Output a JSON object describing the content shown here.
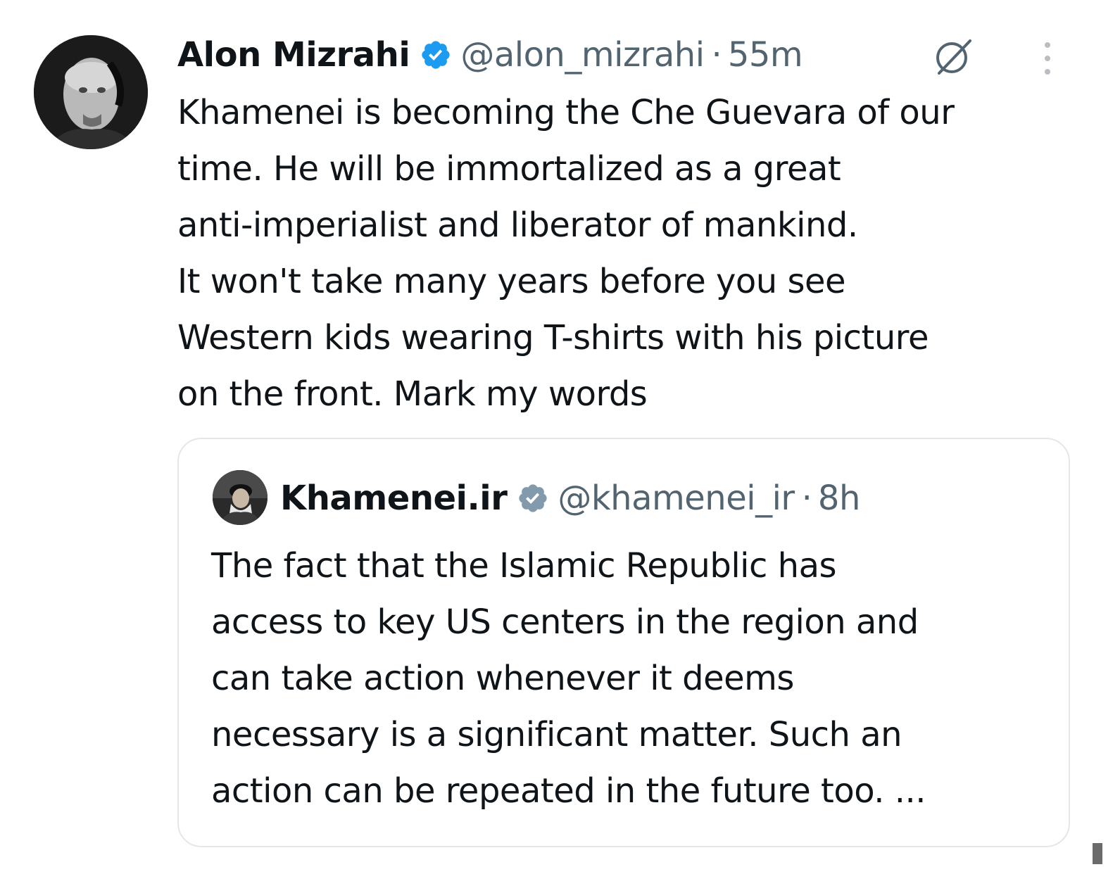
{
  "tweet": {
    "author_name": "Alon Mizrahi",
    "handle": "@alon_mizrahi",
    "separator": "·",
    "time": "55m",
    "text": "Khamenei is becoming the Che Guevara of our\ntime. He will be immortalized as a great\nanti-imperialist and liberator of mankind.\nIt won't take many years before you see\nWestern kids wearing T-shirts with his picture\non the front. Mark my words",
    "verified_color": "#1d9bf0"
  },
  "quoted_tweet": {
    "author_name": "Khamenei.ir",
    "handle": "@khamenei_ir",
    "separator": "·",
    "time": "8h",
    "text": "The fact that the Islamic Republic has\naccess to key US centers in the region and\ncan take action whenever it deems\nnecessary is a significant matter. Such an\naction can be repeated in the future too. ...",
    "verified_color": "#829aab"
  },
  "icons": {
    "avatar": "user-avatar",
    "verified": "verified-badge-icon",
    "grok": "grok-icon",
    "more": "more-options-icon",
    "gray_verified": "gray-verified-badge-icon"
  },
  "colors": {
    "text": "#0f1419",
    "secondary_text": "#536471",
    "card_border": "#e4e7ea"
  }
}
